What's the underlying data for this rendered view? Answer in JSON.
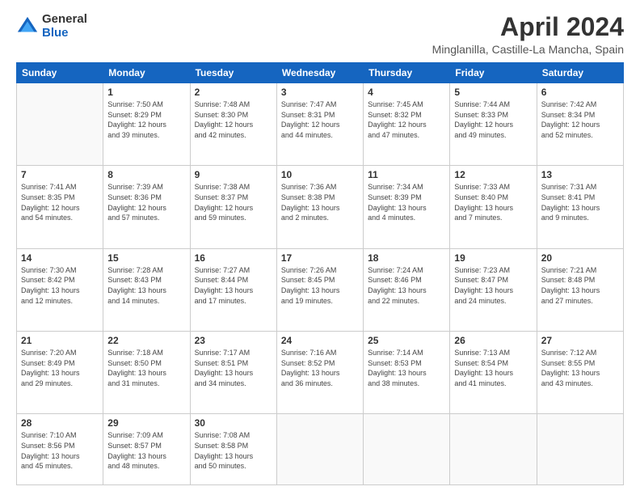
{
  "logo": {
    "general": "General",
    "blue": "Blue"
  },
  "title": "April 2024",
  "subtitle": "Minglanilla, Castille-La Mancha, Spain",
  "days": [
    "Sunday",
    "Monday",
    "Tuesday",
    "Wednesday",
    "Thursday",
    "Friday",
    "Saturday"
  ],
  "weeks": [
    [
      {
        "day": "",
        "info": ""
      },
      {
        "day": "1",
        "info": "Sunrise: 7:50 AM\nSunset: 8:29 PM\nDaylight: 12 hours\nand 39 minutes."
      },
      {
        "day": "2",
        "info": "Sunrise: 7:48 AM\nSunset: 8:30 PM\nDaylight: 12 hours\nand 42 minutes."
      },
      {
        "day": "3",
        "info": "Sunrise: 7:47 AM\nSunset: 8:31 PM\nDaylight: 12 hours\nand 44 minutes."
      },
      {
        "day": "4",
        "info": "Sunrise: 7:45 AM\nSunset: 8:32 PM\nDaylight: 12 hours\nand 47 minutes."
      },
      {
        "day": "5",
        "info": "Sunrise: 7:44 AM\nSunset: 8:33 PM\nDaylight: 12 hours\nand 49 minutes."
      },
      {
        "day": "6",
        "info": "Sunrise: 7:42 AM\nSunset: 8:34 PM\nDaylight: 12 hours\nand 52 minutes."
      }
    ],
    [
      {
        "day": "7",
        "info": "Sunrise: 7:41 AM\nSunset: 8:35 PM\nDaylight: 12 hours\nand 54 minutes."
      },
      {
        "day": "8",
        "info": "Sunrise: 7:39 AM\nSunset: 8:36 PM\nDaylight: 12 hours\nand 57 minutes."
      },
      {
        "day": "9",
        "info": "Sunrise: 7:38 AM\nSunset: 8:37 PM\nDaylight: 12 hours\nand 59 minutes."
      },
      {
        "day": "10",
        "info": "Sunrise: 7:36 AM\nSunset: 8:38 PM\nDaylight: 13 hours\nand 2 minutes."
      },
      {
        "day": "11",
        "info": "Sunrise: 7:34 AM\nSunset: 8:39 PM\nDaylight: 13 hours\nand 4 minutes."
      },
      {
        "day": "12",
        "info": "Sunrise: 7:33 AM\nSunset: 8:40 PM\nDaylight: 13 hours\nand 7 minutes."
      },
      {
        "day": "13",
        "info": "Sunrise: 7:31 AM\nSunset: 8:41 PM\nDaylight: 13 hours\nand 9 minutes."
      }
    ],
    [
      {
        "day": "14",
        "info": "Sunrise: 7:30 AM\nSunset: 8:42 PM\nDaylight: 13 hours\nand 12 minutes."
      },
      {
        "day": "15",
        "info": "Sunrise: 7:28 AM\nSunset: 8:43 PM\nDaylight: 13 hours\nand 14 minutes."
      },
      {
        "day": "16",
        "info": "Sunrise: 7:27 AM\nSunset: 8:44 PM\nDaylight: 13 hours\nand 17 minutes."
      },
      {
        "day": "17",
        "info": "Sunrise: 7:26 AM\nSunset: 8:45 PM\nDaylight: 13 hours\nand 19 minutes."
      },
      {
        "day": "18",
        "info": "Sunrise: 7:24 AM\nSunset: 8:46 PM\nDaylight: 13 hours\nand 22 minutes."
      },
      {
        "day": "19",
        "info": "Sunrise: 7:23 AM\nSunset: 8:47 PM\nDaylight: 13 hours\nand 24 minutes."
      },
      {
        "day": "20",
        "info": "Sunrise: 7:21 AM\nSunset: 8:48 PM\nDaylight: 13 hours\nand 27 minutes."
      }
    ],
    [
      {
        "day": "21",
        "info": "Sunrise: 7:20 AM\nSunset: 8:49 PM\nDaylight: 13 hours\nand 29 minutes."
      },
      {
        "day": "22",
        "info": "Sunrise: 7:18 AM\nSunset: 8:50 PM\nDaylight: 13 hours\nand 31 minutes."
      },
      {
        "day": "23",
        "info": "Sunrise: 7:17 AM\nSunset: 8:51 PM\nDaylight: 13 hours\nand 34 minutes."
      },
      {
        "day": "24",
        "info": "Sunrise: 7:16 AM\nSunset: 8:52 PM\nDaylight: 13 hours\nand 36 minutes."
      },
      {
        "day": "25",
        "info": "Sunrise: 7:14 AM\nSunset: 8:53 PM\nDaylight: 13 hours\nand 38 minutes."
      },
      {
        "day": "26",
        "info": "Sunrise: 7:13 AM\nSunset: 8:54 PM\nDaylight: 13 hours\nand 41 minutes."
      },
      {
        "day": "27",
        "info": "Sunrise: 7:12 AM\nSunset: 8:55 PM\nDaylight: 13 hours\nand 43 minutes."
      }
    ],
    [
      {
        "day": "28",
        "info": "Sunrise: 7:10 AM\nSunset: 8:56 PM\nDaylight: 13 hours\nand 45 minutes."
      },
      {
        "day": "29",
        "info": "Sunrise: 7:09 AM\nSunset: 8:57 PM\nDaylight: 13 hours\nand 48 minutes."
      },
      {
        "day": "30",
        "info": "Sunrise: 7:08 AM\nSunset: 8:58 PM\nDaylight: 13 hours\nand 50 minutes."
      },
      {
        "day": "",
        "info": ""
      },
      {
        "day": "",
        "info": ""
      },
      {
        "day": "",
        "info": ""
      },
      {
        "day": "",
        "info": ""
      }
    ]
  ]
}
